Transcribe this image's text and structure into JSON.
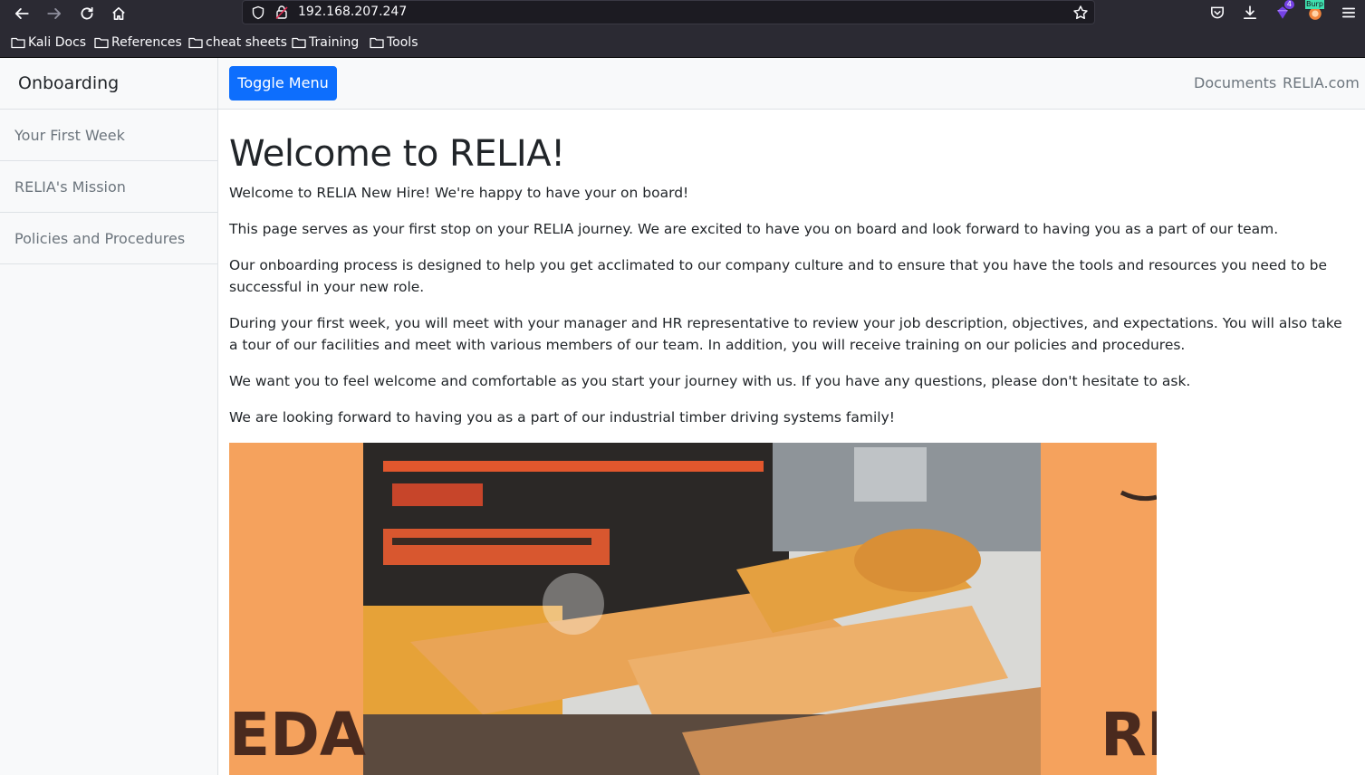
{
  "browser": {
    "url": "192.168.207.247",
    "extension_badge_count": "4",
    "burp_badge": "Burp",
    "bookmarks": [
      "Kali Docs",
      "References",
      "cheat sheets",
      "Training",
      "Tools"
    ]
  },
  "sidebar": {
    "heading": "Onboarding",
    "items": [
      "Your First Week",
      "RELIA's Mission",
      "Policies and Procedures"
    ]
  },
  "topnav": {
    "toggle_label": "Toggle Menu",
    "links": [
      "Documents",
      "RELIA.com"
    ]
  },
  "main": {
    "title": "Welcome to RELIA!",
    "paragraphs": [
      "Welcome to RELIA New Hire! We're happy to have your on board!",
      "This page serves as your first stop on your RELIA journey. We are excited to have you on board and look forward to having you as a part of our team.",
      "Our onboarding process is designed to help you get acclimated to our company culture and to ensure that you have the tools and resources you need to be successful in your new role.",
      "During your first week, you will meet with your manager and HR representative to review your job description, objectives, and expectations. You will also take a tour of our facilities and meet with various members of our team. In addition, you will receive training on our policies and procedures.",
      "We want you to feel welcome and comfortable as you start your journey with us. If you have any questions, please don't hesitate to ask.",
      "We are looking forward to having you as a part of our industrial timber driving systems family!"
    ],
    "hero_image": {
      "text_left": "EDA",
      "text_right": "RF"
    }
  },
  "colors": {
    "primary": "#0d6efd",
    "sidebar_bg": "#f8f9fa",
    "muted_text": "#6c757d",
    "hero_orange": "#f5a25d"
  }
}
